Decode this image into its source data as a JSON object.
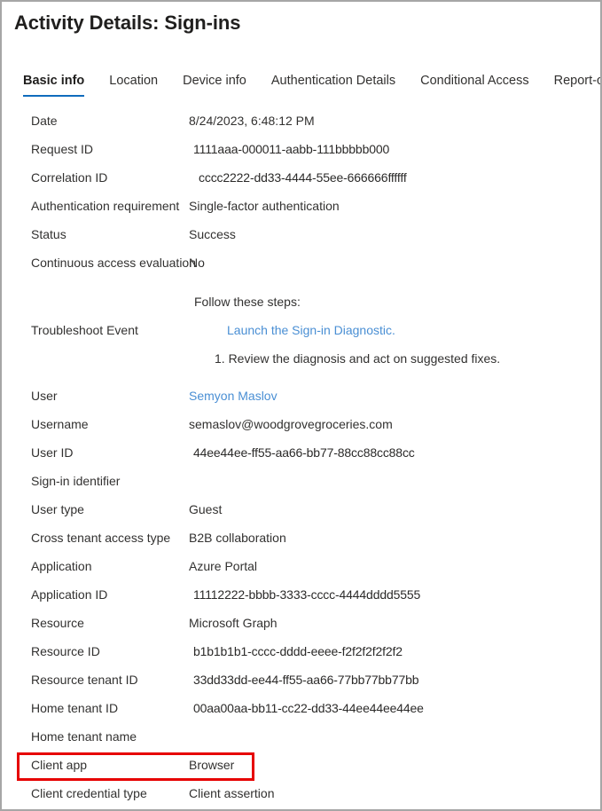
{
  "page": {
    "title": "Activity Details: Sign-ins"
  },
  "tabs": [
    {
      "label": "Basic info",
      "active": true
    },
    {
      "label": "Location",
      "active": false
    },
    {
      "label": "Device info",
      "active": false
    },
    {
      "label": "Authentication Details",
      "active": false
    },
    {
      "label": "Conditional Access",
      "active": false
    },
    {
      "label": "Report-only",
      "active": false
    }
  ],
  "details_top": [
    {
      "label": "Date",
      "value": "8/24/2023, 6:48:12 PM",
      "style": "plain"
    },
    {
      "label": "Request ID",
      "value": "1111aaa-000011-aabb-111bbbbb000",
      "style": "guid"
    },
    {
      "label": "Correlation ID",
      "value": "cccc2222-dd33-4444-55ee-666666ffffff",
      "style": "indent"
    },
    {
      "label": "Authentication requirement",
      "value": "Single-factor authentication",
      "style": "plain"
    },
    {
      "label": "Status",
      "value": "Success",
      "style": "plain"
    },
    {
      "label": "Continuous access evaluation",
      "value": "No",
      "style": "plain"
    }
  ],
  "troubleshoot": {
    "label": "Troubleshoot Event",
    "lead": "Follow these steps:",
    "link": "Launch the Sign-in Diagnostic.",
    "step": "1. Review the diagnosis and act on suggested fixes."
  },
  "details_user": [
    {
      "label": "User",
      "value": "Semyon Maslov",
      "style": "link"
    },
    {
      "label": "Username",
      "value": "semaslov@woodgrovegroceries.com",
      "style": "plain"
    },
    {
      "label": "User ID",
      "value": "44ee44ee-ff55-aa66-bb77-88cc88cc88cc",
      "style": "guid"
    },
    {
      "label": "Sign-in identifier",
      "value": "",
      "style": "plain"
    },
    {
      "label": "User type",
      "value": "Guest",
      "style": "plain"
    },
    {
      "label": "Cross tenant access type",
      "value": "B2B collaboration",
      "style": "plain"
    },
    {
      "label": "Application",
      "value": "Azure Portal",
      "style": "plain"
    },
    {
      "label": "Application ID",
      "value": "11112222-bbbb-3333-cccc-4444dddd5555",
      "style": "guid"
    },
    {
      "label": "Resource",
      "value": "Microsoft Graph",
      "style": "plain"
    },
    {
      "label": "Resource ID",
      "value": "b1b1b1b1-cccc-dddd-eeee-f2f2f2f2f2f2",
      "style": "guid"
    },
    {
      "label": "Resource tenant ID",
      "value": "33dd33dd-ee44-ff55-aa66-77bb77bb77bb",
      "style": "guid"
    },
    {
      "label": "Home tenant ID",
      "value": "00aa00aa-bb11-cc22-dd33-44ee44ee44ee",
      "style": "guid"
    },
    {
      "label": "Home tenant name",
      "value": "",
      "style": "plain"
    },
    {
      "label": "Client app",
      "value": "Browser",
      "style": "plain"
    },
    {
      "label": "Client credential type",
      "value": "Client assertion",
      "style": "plain"
    }
  ],
  "highlight": {
    "target_label": "Client app",
    "color": "#e60000"
  },
  "colors": {
    "accent": "#0f6cbd",
    "link": "#4a8fd4",
    "text": "#323130",
    "border": "#a6a6a6",
    "highlight": "#e60000"
  }
}
